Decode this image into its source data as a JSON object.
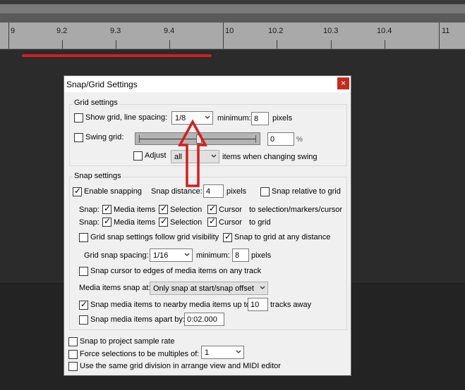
{
  "ruler": {
    "labels": [
      "9",
      "9.2",
      "9.3",
      "9.4",
      "10",
      "10.2",
      "10.3",
      "10.4",
      "11"
    ]
  },
  "dialog": {
    "title": "Snap/Grid Settings",
    "close_glyph": "×",
    "grid_settings": {
      "legend": "Grid settings",
      "show_grid_label": "Show grid, line spacing:",
      "show_grid_checked": false,
      "line_spacing_value": "1/8",
      "minimum_label": "minimum:",
      "minimum_value": "8",
      "pixels_label": "pixels",
      "swing_label": "Swing grid:",
      "swing_checked": false,
      "swing_level_fraction": 0.5,
      "swing_value": "0",
      "percent_label": "%",
      "adjust_label": "Adjust",
      "adjust_checked": false,
      "adjust_value": "all",
      "adjust_suffix": "items when changing swing"
    },
    "snap_settings": {
      "legend": "Snap settings",
      "enable_label": "Enable snapping",
      "enable_checked": true,
      "snap_distance_label": "Snap distance:",
      "snap_distance_value": "4",
      "snap_distance_unit": "pixels",
      "snap_relative_label": "Snap relative to grid",
      "snap_relative_checked": false,
      "row1": {
        "prefix": "Snap:",
        "media_label": "Media items",
        "media_checked": true,
        "selection_label": "Selection",
        "selection_checked": true,
        "cursor_label": "Cursor",
        "cursor_checked": true,
        "suffix": "to selection/markers/cursor"
      },
      "row2": {
        "prefix": "Snap:",
        "media_label": "Media items",
        "media_checked": true,
        "selection_label": "Selection",
        "selection_checked": true,
        "cursor_label": "Cursor",
        "cursor_checked": true,
        "suffix": "to grid"
      },
      "follow_grid_label": "Grid snap settings follow grid visibility",
      "follow_grid_checked": false,
      "any_distance_label": "Snap to grid at any distance",
      "any_distance_checked": true,
      "grid_snap_spacing_label": "Grid snap spacing:",
      "grid_snap_spacing_value": "1/16",
      "minimum_label": "minimum:",
      "minimum_value": "8",
      "pixels_label": "pixels",
      "cursor_edges_label": "Snap cursor to edges of media items on any track",
      "cursor_edges_checked": false,
      "media_snap_at_label": "Media items snap at:",
      "media_snap_at_value": "Only snap at start/snap offset",
      "nearby_label": "Snap media items to nearby media items up to:",
      "nearby_checked": true,
      "nearby_value": "10",
      "nearby_suffix": "tracks away",
      "apart_label": "Snap media items apart by:",
      "apart_checked": false,
      "apart_value": "0:02.000"
    },
    "bottom": {
      "sample_rate_label": "Snap to project sample rate",
      "sample_rate_checked": false,
      "multiples_label": "Force selections to be multiples of:",
      "multiples_checked": false,
      "multiples_value": "1",
      "same_grid_label": "Use the same grid division in arrange view and MIDI editor",
      "same_grid_checked": false
    }
  },
  "colors": {
    "annotation_red": "#d11f1f",
    "close_red": "#c42b1c"
  }
}
